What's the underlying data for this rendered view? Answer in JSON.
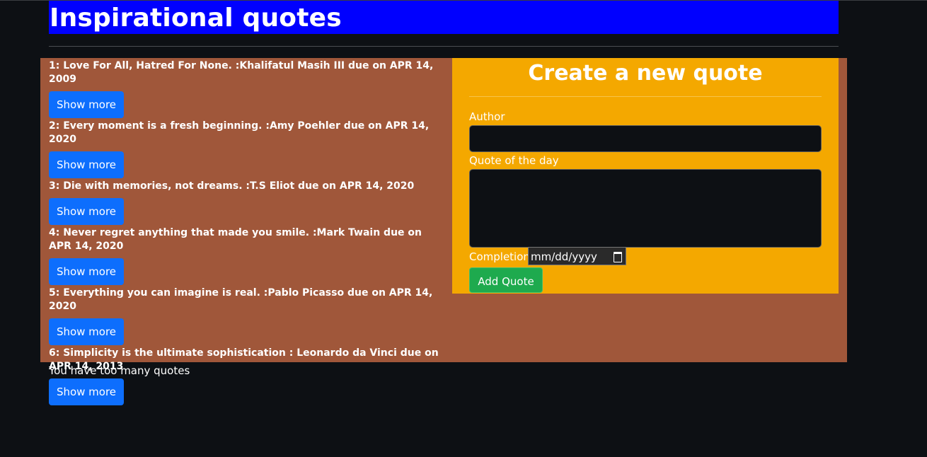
{
  "header": {
    "title": "Inspirational quotes"
  },
  "quotes": [
    {
      "text": "1: Love For All, Hatred For None. :Khalifatul Masih III due on APR 14, 2009",
      "button": "Show more"
    },
    {
      "text": "2: Every moment is a fresh beginning. :Amy Poehler due on APR 14, 2020",
      "button": "Show more"
    },
    {
      "text": "3: Die with memories, not dreams. :T.S Eliot due on APR 14, 2020",
      "button": "Show more"
    },
    {
      "text": "4: Never regret anything that made you smile. :Mark Twain due on APR 14, 2020",
      "button": "Show more"
    },
    {
      "text": "5: Everything you can imagine is real. :Pablo Picasso due on APR 14, 2020",
      "button": "Show more"
    },
    {
      "text": "6: Simplicity is the ultimate sophistication : Leonardo da Vinci due on APR 14, 2013",
      "button": "Show more"
    }
  ],
  "form": {
    "title": "Create a new quote",
    "author_label": "Author",
    "author_value": "",
    "quote_label": "Quote of the day",
    "quote_value": "",
    "completion_label": "Completion",
    "completion_placeholder": "mm/dd/yyyy",
    "submit_label": "Add Quote"
  },
  "footer": {
    "message": "You have too many quotes"
  },
  "colors": {
    "header_bg": "#0000ff",
    "content_bg": "#a0573a",
    "form_bg": "#f4a800",
    "show_button": "#0d6efd",
    "add_button": "#1eaa4e",
    "page_bg": "#0d1014"
  },
  "icons": {
    "date_picker": "calendar-icon"
  }
}
